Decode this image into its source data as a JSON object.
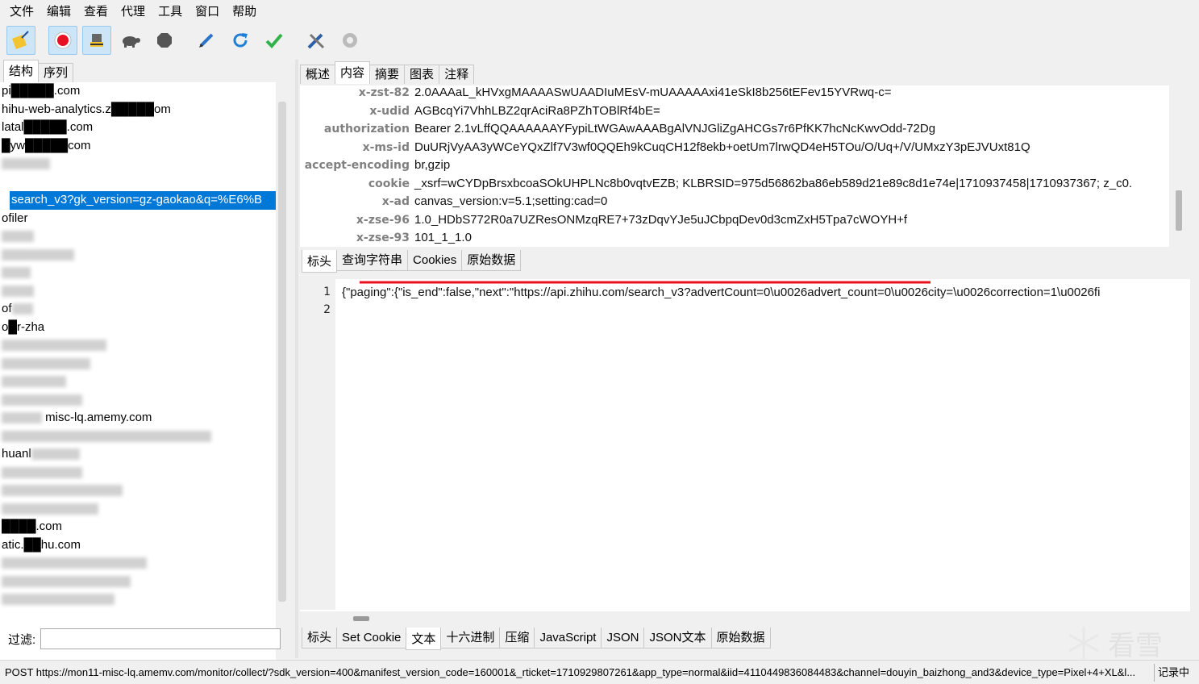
{
  "menu": [
    "文件",
    "编辑",
    "查看",
    "代理",
    "工具",
    "窗口",
    "帮助"
  ],
  "toolbar": {
    "icons": [
      "broom-icon",
      "record-icon",
      "intercept-icon",
      "throttle-icon",
      "stop-icon",
      "compose-icon",
      "repeat-icon",
      "validate-icon",
      "tools-icon",
      "settings-icon"
    ],
    "accent": "#0078d7",
    "record_color": "#e81123"
  },
  "left": {
    "tabs": [
      "结构",
      "序列"
    ],
    "tree": [
      "pi█████.com",
      "hihu-web-analytics.z█████om",
      "latal█████.com",
      "█yw█████com",
      "",
      "",
      "search_v3?gk_version=gz-gaokao&q=%E6%B",
      "ofiler",
      "",
      "",
      "",
      "",
      "of",
      "o█r-zha",
      "",
      "",
      "",
      "",
      "misc-lq.amemy.com",
      "",
      "huanl",
      "",
      "",
      "",
      "████.com",
      "atic.██hu.com",
      "",
      ""
    ],
    "filter_label": "过滤:",
    "filter_value": ""
  },
  "right": {
    "tabs": [
      "概述",
      "内容",
      "摘要",
      "图表",
      "注释"
    ],
    "headers": [
      {
        "key": "x-zst-82",
        "value": "2.0AAAaL_kHVxgMAAAASwUAADIuMEsV-mUAAAAAxi41eSkI8b256tEFev15YVRwq-c="
      },
      {
        "key": "x-udid",
        "value": "AGBcqYi7VhhLBZ2qrAciRa8PZhTOBlRf4bE="
      },
      {
        "key": "authorization",
        "value": "Bearer 2.1vLffQQAAAAAAYFypiLtWGAwAAABgAlVNJGliZgAHCGs7r6PfKK7hcNcKwvOdd-72Dg"
      },
      {
        "key": "x-ms-id",
        "value": "DuURjVyAA3yWCeYQxZlf7V3wf0QQEh9kCuqCH12f8ekb+oetUm7lrwQD4eH5TOu/O/Uq+/V/UMxzY3pEJVUxt81Q"
      },
      {
        "key": "accept-encoding",
        "value": "br,gzip"
      },
      {
        "key": "cookie",
        "value": "_xsrf=wCYDpBrsxbcoaSOkUHPLNc8b0vqtvEZB; KLBRSID=975d56862ba86eb589d21e89c8d1e74e|1710937458|1710937367; z_c0."
      },
      {
        "key": "x-ad",
        "value": "canvas_version:v=5.1;setting:cad=0"
      },
      {
        "key": "x-zse-96",
        "value": "1.0_HDbS772R0a7UZResONMzqRE7+73zDqvYJe5uJCbpqDev0d3cmZxH5Tpa7cWOYH+f"
      },
      {
        "key": "x-zse-93",
        "value": "101_1_1.0"
      }
    ],
    "request_tabs": [
      "标头",
      "查询字符串",
      "Cookies",
      "原始数据"
    ],
    "body": {
      "line_numbers": [
        "1",
        "2"
      ],
      "line1": "{\"paging\":{\"is_end\":false,\"next\":\"https://api.zhihu.com/search_v3?advertCount=0\\u0026advert_count=0\\u0026city=\\u0026correction=1\\u0026fi",
      "line2": ""
    },
    "response_tabs": [
      "标头",
      "Set Cookie",
      "文本",
      "十六进制",
      "压缩",
      "JavaScript",
      "JSON",
      "JSON文本",
      "原始数据"
    ],
    "highlight_color": "#e8101e"
  },
  "watermark": "看雪",
  "status": {
    "text": "POST https://mon11-misc-lq.amemv.com/monitor/collect/?sdk_version=400&manifest_version_code=160001&_rticket=1710929807261&app_type=normal&iid=4110449836084483&channel=douyin_baizhong_and3&device_type=Pixel+4+XL&l...",
    "badge": "记录中"
  }
}
